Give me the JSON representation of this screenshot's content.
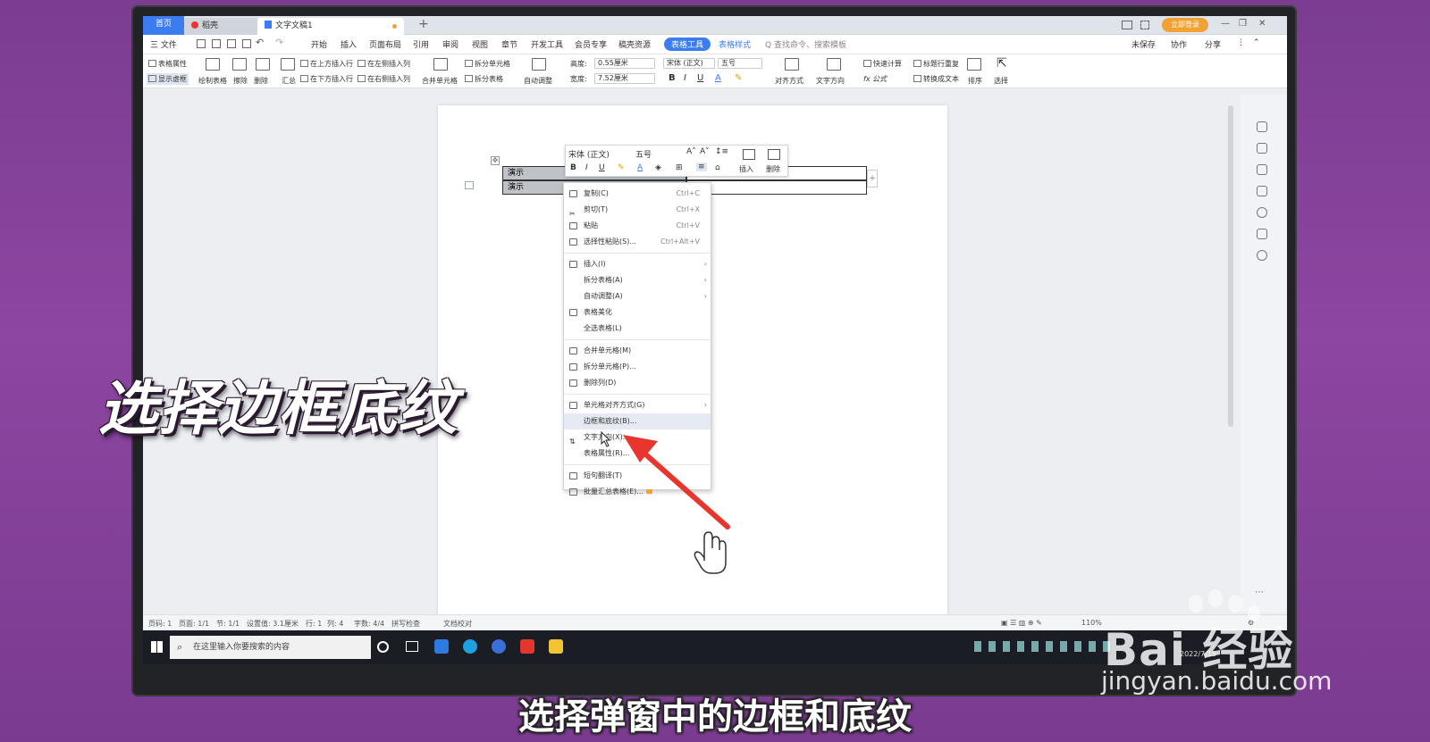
{
  "tabs": {
    "home": "首页",
    "second": "稻壳",
    "doc": "文字文稿1",
    "plus": "+",
    "login": "立即登录"
  },
  "menu": {
    "file": "三 文件",
    "items": [
      "开始",
      "插入",
      "页面布局",
      "引用",
      "审阅",
      "视图",
      "章节",
      "开发工具",
      "会员专享",
      "稿壳资源"
    ],
    "active": "表格工具",
    "style": "表格样式",
    "search": "Q 查找命令、搜索模板",
    "unsaved": "未保存",
    "collab": "协作",
    "share": "分享"
  },
  "ribbon": {
    "table_props": "表格属性",
    "show_gridlines": "显示虚框",
    "draw_table": "绘制表格",
    "erase": "擦除",
    "delete": "删除",
    "summary": "汇总",
    "insert_above": "在上方插入行",
    "insert_below": "在下方插入行",
    "insert_left": "在左侧插入列",
    "insert_right": "在右侧插入列",
    "merge_cells": "合并单元格",
    "split_cells": "拆分单元格",
    "split_table": "拆分表格",
    "auto_fit": "自动调整",
    "height_label": "高度:",
    "height_value": "0.55厘米",
    "width_label": "宽度:",
    "width_value": "7.52厘米",
    "font": "宋体 (正文)",
    "size": "五号",
    "align": "对齐方式",
    "text_dir": "文字方向",
    "quick_calc": "快速计算",
    "header_repeat": "标题行重复",
    "to_text": "转换成文本",
    "formula": "fx 公式",
    "sort": "排序",
    "select": "选择"
  },
  "document": {
    "cell_1": "演示",
    "cell_2": "演示"
  },
  "mini_toolbar": {
    "font": "宋体 (正文)",
    "size": "五号",
    "insert": "插入",
    "delete": "删除"
  },
  "context_menu": [
    {
      "label": "复制(C)",
      "shortcut": "Ctrl+C"
    },
    {
      "label": "剪切(T)",
      "shortcut": "Ctrl+X"
    },
    {
      "label": "粘贴",
      "shortcut": "Ctrl+V"
    },
    {
      "label": "选择性粘贴(S)...",
      "shortcut": "Ctrl+Alt+V"
    },
    {
      "label": "插入(I)"
    },
    {
      "label": "拆分表格(A)"
    },
    {
      "label": "自动调整(A)"
    },
    {
      "label": "表格美化"
    },
    {
      "label": "全选表格(L)"
    },
    {
      "label": "合并单元格(M)"
    },
    {
      "label": "拆分单元格(P)..."
    },
    {
      "label": "删除列(D)"
    },
    {
      "label": "单元格对齐方式(G)"
    },
    {
      "label": "边框和底纹(B)..."
    },
    {
      "label": "文字方向(X)..."
    },
    {
      "label": "表格属性(R)..."
    },
    {
      "label": "短句翻译(T)"
    },
    {
      "label": "批量汇总表格(E)..."
    }
  ],
  "status": {
    "pages": "页码: 1",
    "page_of": "页面: 1/1",
    "section": "节: 1/1",
    "position": "设置值: 3.1厘米",
    "row": "行: 1",
    "col": "列: 4",
    "words": "字数: 4/4",
    "spell": "拼写检查",
    "proof": "文档校对",
    "zoom": "110%"
  },
  "taskbar": {
    "search": "在这里输入你要搜索的内容",
    "date": "2022/7/15"
  },
  "captions": {
    "overlay": "选择边框底纹",
    "subtitle": "选择弹窗中的边框和底纹"
  },
  "watermark": {
    "brand": "Bai 经验",
    "url": "jingyan.baidu.com"
  },
  "colors": {
    "accent": "#3b7cf0",
    "arrow": "#e8352d",
    "background": "#8a44a0"
  }
}
